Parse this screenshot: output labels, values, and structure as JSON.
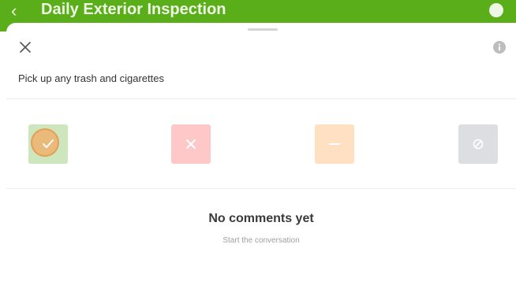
{
  "header": {
    "title": "Daily Exterior Inspection",
    "back_icon": "chevron-left-icon",
    "info_icon": "info-icon",
    "color": "#5aae1a"
  },
  "sheet": {
    "close_icon": "close-icon",
    "info_icon": "info-icon",
    "task_title": "Pick up any trash and cigarettes"
  },
  "response_options": [
    {
      "name": "pass",
      "icon": "checkmark-icon",
      "color": "#cde6bd",
      "selected": true
    },
    {
      "name": "fail",
      "icon": "x-icon",
      "color": "#ffc8c8",
      "selected": false
    },
    {
      "name": "not-applicable",
      "icon": "dash-icon",
      "color": "#ffe0c2",
      "selected": false
    },
    {
      "name": "skip",
      "icon": "prohibited-icon",
      "color": "#dcdee1",
      "selected": false
    }
  ],
  "comments": {
    "empty_title": "No comments yet",
    "empty_subtitle": "Start the conversation"
  }
}
